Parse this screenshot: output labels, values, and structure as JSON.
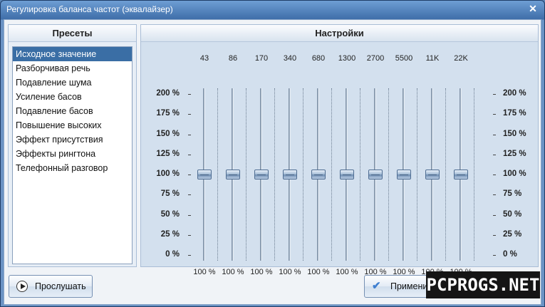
{
  "window": {
    "title": "Регулировка баланса частот (эквалайзер)",
    "close_glyph": "✕"
  },
  "presets": {
    "header": "Пресеты",
    "items": [
      {
        "label": "Исходное значение",
        "selected": true
      },
      {
        "label": "Разборчивая речь"
      },
      {
        "label": "Подавление шума"
      },
      {
        "label": "Усиление басов"
      },
      {
        "label": "Подавление басов"
      },
      {
        "label": "Повышение высоких"
      },
      {
        "label": "Эффект присутствия"
      },
      {
        "label": "Эффекты рингтона"
      },
      {
        "label": "Телефонный разговор"
      }
    ]
  },
  "settings": {
    "header": "Настройки",
    "scale": [
      "200 %",
      "175 %",
      "150 %",
      "125 %",
      "100 %",
      "75 %",
      "50 %",
      "25 %",
      "0 %"
    ],
    "bands": [
      {
        "freq": "43",
        "value": "100 %",
        "level": 100
      },
      {
        "freq": "86",
        "value": "100 %",
        "level": 100
      },
      {
        "freq": "170",
        "value": "100 %",
        "level": 100
      },
      {
        "freq": "340",
        "value": "100 %",
        "level": 100
      },
      {
        "freq": "680",
        "value": "100 %",
        "level": 100
      },
      {
        "freq": "1300",
        "value": "100 %",
        "level": 100
      },
      {
        "freq": "2700",
        "value": "100 %",
        "level": 100
      },
      {
        "freq": "5500",
        "value": "100 %",
        "level": 100
      },
      {
        "freq": "11K",
        "value": "100 %",
        "level": 100
      },
      {
        "freq": "22K",
        "value": "100 %",
        "level": 100
      }
    ]
  },
  "buttons": {
    "listen": "Прослушать",
    "apply": "Применить"
  },
  "watermark": "PCPROGS.NET",
  "colors": {
    "titlebar": "#3f6ea9",
    "selection": "#3a6ea5",
    "panel_bg": "#d3e0ee"
  }
}
